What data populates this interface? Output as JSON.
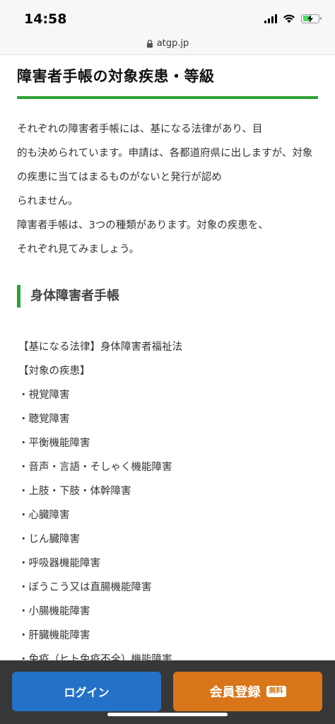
{
  "status": {
    "time": "14:58"
  },
  "browser": {
    "url": "atgp.jp"
  },
  "article": {
    "heading": "障害者手帳の対象疾患・等級",
    "intro_lines": [
      "それぞれの障害者手帳には、基になる法律があり、目",
      "的も決められています。申請は、各都道府県に出しますが、対象の疾患に当てはまるものがないと発行が認め",
      "られません。",
      "障害者手帳は、3つの種類があります。対象の疾患を、",
      "それぞれ見てみましょう。"
    ],
    "section": {
      "heading": "身体障害者手帳",
      "law": "【基になる法律】身体障害者福祉法",
      "diseases_label": "【対象の疾患】",
      "diseases": [
        "・視覚障害",
        "・聴覚障害",
        "・平衡機能障害",
        "・音声・言語・そしゃく機能障害",
        "・上肢・下肢・体幹障害",
        "・心臓障害",
        "・じん臓障害",
        "・呼吸器機能障害",
        "・ぼうこう又は直腸機能障害",
        "・小腸機能障害",
        "・肝臓機能障害",
        "・免疫（ヒト免疫不全）機能障害"
      ]
    }
  },
  "actions": {
    "login_label": "ログイン",
    "register_label": "会員登録",
    "free_badge": "無料"
  },
  "colors": {
    "accent_green": "#2aa234",
    "login_blue": "#2471c8",
    "register_orange": "#d9761a"
  },
  "icons": {
    "signal": "cellular-signal-icon",
    "wifi": "wifi-icon",
    "battery": "battery-charging-icon",
    "lock": "lock-icon"
  }
}
